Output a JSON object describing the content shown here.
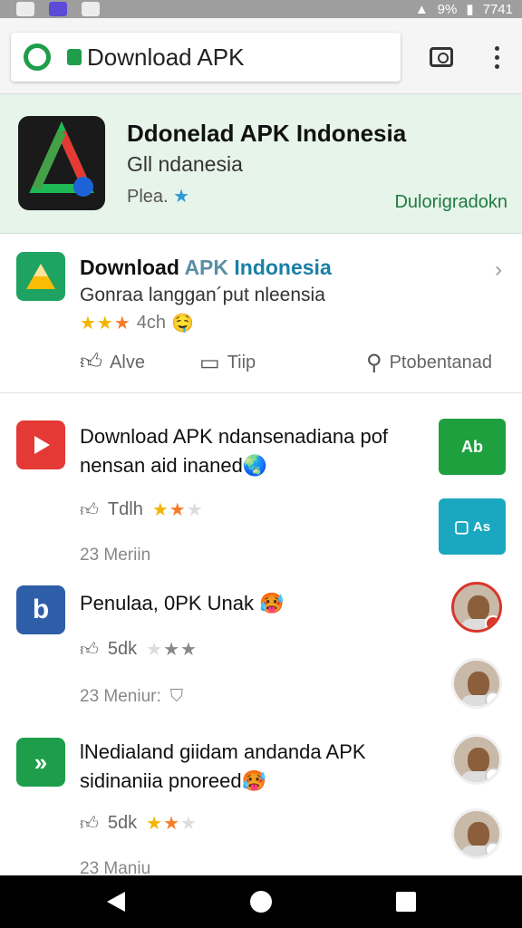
{
  "status": {
    "battery": "9%",
    "time": "7741"
  },
  "toolbar": {
    "url_text": "Download APK"
  },
  "hero": {
    "title": "Ddonelad APK Indonesia",
    "subtitle": "Gll ndanesia",
    "rating_text": "Plea.",
    "link": "Dulorigradokn"
  },
  "featured": {
    "title_part1": "Download",
    "title_part2": "APK",
    "title_part3": "Indonesia",
    "description": "Gonraa langgan´put nleensia",
    "rating_text": "4ch",
    "actions": {
      "like": "Alve",
      "comment": "Tiip",
      "share": "Ptobentanad"
    }
  },
  "items": [
    {
      "title": "Download APK ndansenadiana pof nensan aid inaned🌏",
      "likes": "Tdlh",
      "date": "23 Meriin",
      "tile_label": "Ab"
    },
    {
      "title": "Penulaa, 0PK Unak 🥵",
      "likes": "5dk",
      "date": "23 Meniur:",
      "tile_label": "As"
    },
    {
      "title": "lNedialand giidam andanda APK sidinaniia pnoreed🥵",
      "likes": "5dk",
      "date": "23 Maniu"
    }
  ]
}
